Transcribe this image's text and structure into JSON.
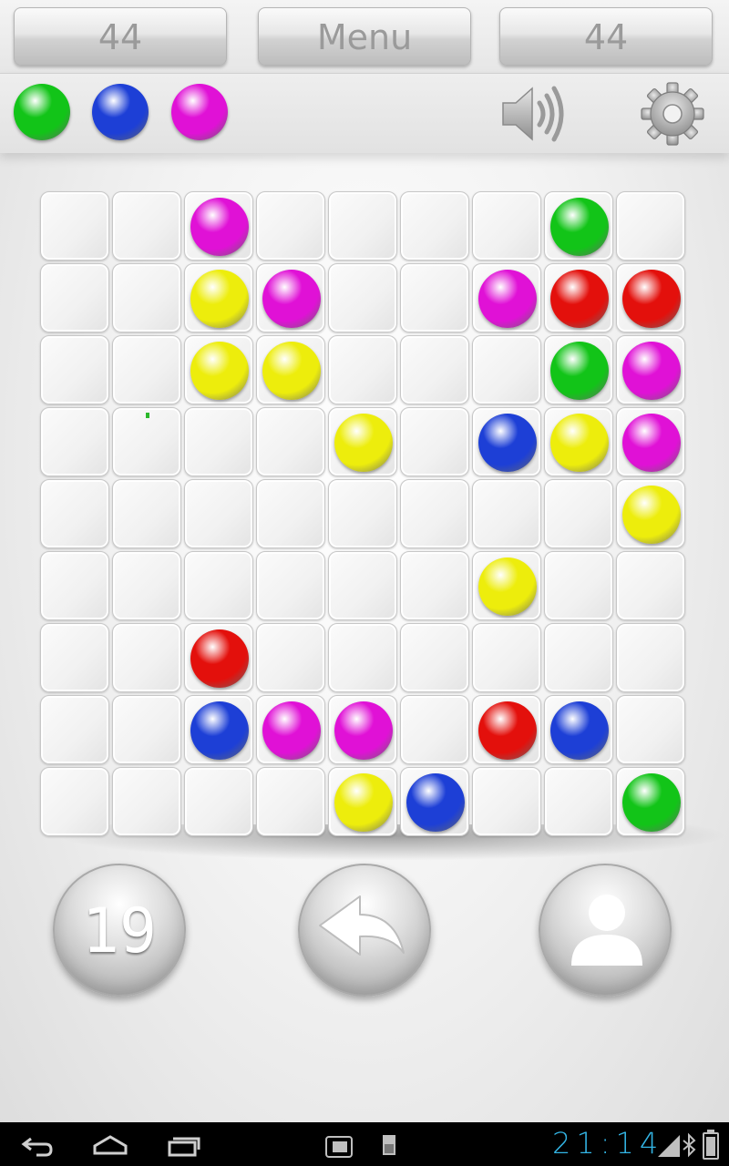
{
  "header": {
    "left_score": "44",
    "menu_label": "Menu",
    "right_score": "44"
  },
  "next_balls": [
    "green",
    "blue",
    "magenta"
  ],
  "toolbar_icons": [
    "speaker-icon",
    "gear-icon"
  ],
  "ball_colors": {
    "green": "#12c418",
    "blue": "#1d3fd6",
    "magenta": "#e011d6",
    "yellow": "#eded0c",
    "red": "#e3100c"
  },
  "board": {
    "rows": 9,
    "cols": 9,
    "cells": [
      [
        "",
        "",
        "magenta",
        "",
        "",
        "",
        "",
        "green",
        ""
      ],
      [
        "",
        "",
        "yellow",
        "magenta",
        "",
        "",
        "magenta",
        "red",
        "red"
      ],
      [
        "",
        "",
        "yellow",
        "yellow",
        "",
        "",
        "",
        "green",
        "magenta"
      ],
      [
        "",
        "",
        "",
        "",
        "yellow",
        "",
        "blue",
        "yellow",
        "magenta"
      ],
      [
        "",
        "",
        "",
        "",
        "",
        "",
        "",
        "",
        "yellow"
      ],
      [
        "",
        "",
        "",
        "",
        "",
        "",
        "yellow",
        "",
        ""
      ],
      [
        "",
        "",
        "red",
        "",
        "",
        "",
        "",
        "",
        ""
      ],
      [
        "",
        "",
        "blue",
        "magenta",
        "magenta",
        "",
        "red",
        "blue",
        ""
      ],
      [
        "",
        "",
        "",
        "",
        "yellow",
        "blue",
        "",
        "",
        "green"
      ]
    ]
  },
  "controls": {
    "moves_count": "19",
    "undo_icon": "undo-arrow-icon",
    "profile_icon": "user-icon"
  },
  "status_bar": {
    "clock": "21:14",
    "nav_icons": [
      "back-icon",
      "home-icon",
      "recent-apps-icon"
    ],
    "notification_icons": [
      "screenshot-icon",
      "sd-card-icon"
    ],
    "system_icons": [
      "signal-icon",
      "bluetooth-icon",
      "battery-icon"
    ]
  }
}
